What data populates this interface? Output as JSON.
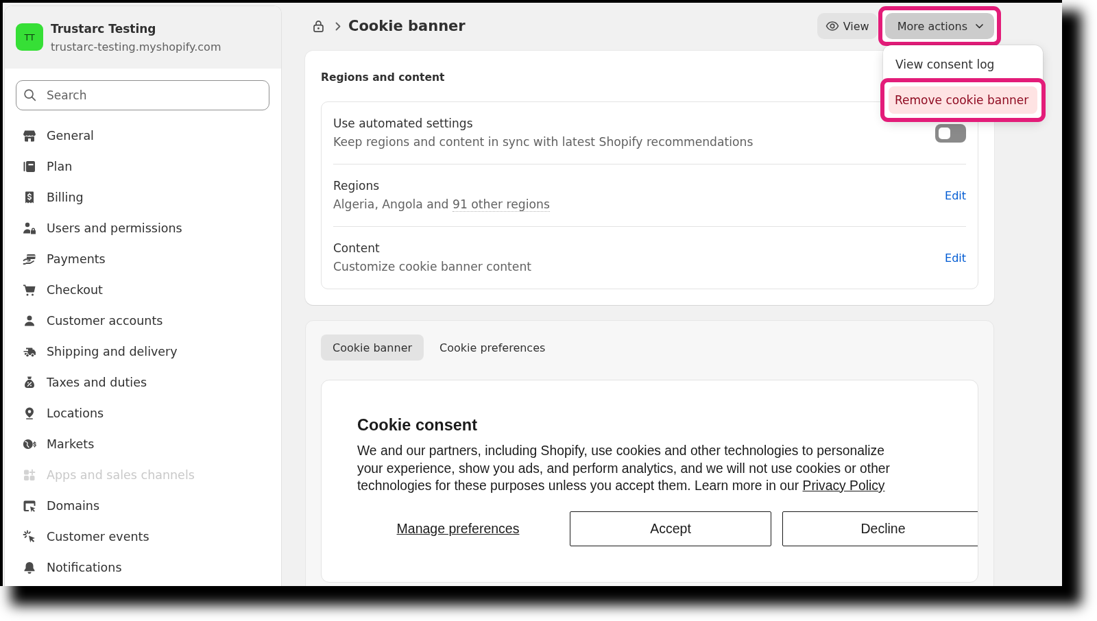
{
  "store": {
    "initials": "TT",
    "name": "Trustarc Testing",
    "domain": "trustarc-testing.myshopify.com"
  },
  "sidebar": {
    "search": {
      "placeholder": "Search"
    },
    "items": [
      {
        "label": "General",
        "disabled": false
      },
      {
        "label": "Plan",
        "disabled": false
      },
      {
        "label": "Billing",
        "disabled": false
      },
      {
        "label": "Users and permissions",
        "disabled": false
      },
      {
        "label": "Payments",
        "disabled": false
      },
      {
        "label": "Checkout",
        "disabled": false
      },
      {
        "label": "Customer accounts",
        "disabled": false
      },
      {
        "label": "Shipping and delivery",
        "disabled": false
      },
      {
        "label": "Taxes and duties",
        "disabled": false
      },
      {
        "label": "Locations",
        "disabled": false
      },
      {
        "label": "Markets",
        "disabled": false
      },
      {
        "label": "Apps and sales channels",
        "disabled": true
      },
      {
        "label": "Domains",
        "disabled": false
      },
      {
        "label": "Customer events",
        "disabled": false
      },
      {
        "label": "Notifications",
        "disabled": false
      }
    ]
  },
  "header": {
    "title": "Cookie banner",
    "view_button": {
      "label": "View"
    },
    "more_actions": {
      "label": "More actions",
      "expanded": true,
      "highlighted": true
    },
    "menu": [
      {
        "label": "View consent log",
        "destructive": false,
        "hovered": false,
        "highlighted": false
      },
      {
        "label": "Remove cookie banner",
        "destructive": true,
        "hovered": true,
        "highlighted": true
      }
    ]
  },
  "regions_and_content": {
    "title": "Regions and content",
    "rows": [
      {
        "kind": "toggle",
        "title": "Use automated settings",
        "description": "Keep regions and content in sync with latest Shopify recommendations",
        "on": false
      },
      {
        "kind": "edit",
        "title": "Regions",
        "description": "Algeria, Angola and",
        "description_link": "91 other regions",
        "action": "Edit"
      },
      {
        "kind": "edit",
        "title": "Content",
        "description": "Customize cookie banner content",
        "action": "Edit"
      }
    ]
  },
  "preview": {
    "tabs": [
      {
        "label": "Cookie banner",
        "selected": true
      },
      {
        "label": "Cookie preferences",
        "selected": false
      }
    ],
    "banner": {
      "title": "Cookie consent",
      "body": "We and our partners, including Shopify, use cookies and other technologies to personalize your experience, show you ads, and perform analytics, and we will not use cookies or other technologies for these purposes unless you accept them. Learn more in our",
      "policy_link": "Privacy Policy",
      "manage_link": "Manage preferences",
      "buttons": [
        "Accept",
        "Decline"
      ]
    }
  }
}
